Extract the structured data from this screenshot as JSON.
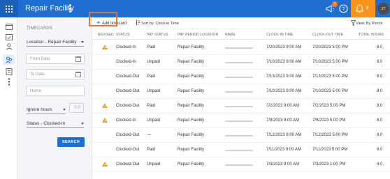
{
  "app": {
    "title": "Repair Facility",
    "notification_badge": "7",
    "alerts_count": "8",
    "user_initials": "JT",
    "accent_color": "#1f6fd1",
    "alert_color": "#f7941d"
  },
  "rail_icons": [
    "calendar-icon",
    "calendar-check-icon",
    "user-icon",
    "users-icon",
    "document-icon",
    "more-icon"
  ],
  "filters": {
    "title": "TIMECARDS",
    "location": "Location - Repair Facility",
    "from_date_placeholder": "From Date",
    "to_date_placeholder": "To Date",
    "name_placeholder": "Name",
    "ignore_hours": "Ignore hours",
    "ignore_value": "0.0",
    "status": "Status - Clocked-In",
    "search_label": "SEARCH"
  },
  "toolbar": {
    "add_label": "Add timecard",
    "sort_label": "Sort by: Clock-in Time",
    "view_label": "View: By Punch"
  },
  "columns": [
    "REVISED",
    "STATUS",
    "PAY STATUS",
    "PAY PERIOD LOCATION",
    "NAME",
    "CLOCK-IN TIME",
    "CLOCK-OUT TIME",
    "TOTAL HOURS"
  ],
  "rows": [
    {
      "revised": true,
      "status": "Clocked-In",
      "pay_status": "Paid",
      "location": "Repair Facility",
      "clock_in": "7/20/2023 9:00 AM",
      "clock_out": "7/20/2023 5:00 PM",
      "hours": "8.0"
    },
    {
      "revised": false,
      "status": "Clocked-In",
      "pay_status": "Unpaid",
      "location": "Repair Facility",
      "clock_in": "7/10/2023 9:00 AM",
      "clock_out": "7/10/2023 5:00 PM",
      "hours": "8.0"
    },
    {
      "revised": false,
      "status": "Clocked-Out",
      "pay_status": "Paid",
      "location": "Repair Facility",
      "clock_in": "7/13/2023 9:00 AM",
      "clock_out": "7/13/2023 5:00 PM",
      "hours": "8.0"
    },
    {
      "revised": false,
      "status": "Clocked-Out",
      "pay_status": "Unpaid",
      "location": "Repair Facility",
      "clock_in": "7/10/2023 9:00 AM",
      "clock_out": "7/10/2023 5:00 PM",
      "hours": "8.0"
    },
    {
      "revised": true,
      "status": "Clocked-Out",
      "pay_status": "Paid",
      "location": "Repair Facility",
      "clock_in": "7/2/2023 9:00 AM",
      "clock_out": "7/2/2023 5:00 PM",
      "hours": "8.0"
    },
    {
      "revised": true,
      "status": "Clocked-In",
      "pay_status": "Unpaid",
      "location": "Repair Facility",
      "clock_in": "7/9/2023 9:00 AM",
      "clock_out": "7/9/2023 5:00 PM",
      "hours": "8.0"
    },
    {
      "revised": false,
      "status": "Clocked-Out",
      "pay_status": "—",
      "location": "Repair Facility",
      "clock_in": "7/12/2023 9:00 AM",
      "clock_out": "7/12/2023 5:00 PM",
      "hours": "8.0"
    },
    {
      "revised": false,
      "status": "Clocked-Out",
      "pay_status": "Paid",
      "location": "Repair Facility",
      "clock_in": "7/11/2023 9:00 AM",
      "clock_out": "7/11/2023 5:00 PM",
      "hours": "8.0"
    },
    {
      "revised": true,
      "status": "Clocked-Out",
      "pay_status": "Unpaid",
      "location": "Repair Facility",
      "clock_in": "7/3/2023 9:00 AM",
      "clock_out": "7/3/2023 1:00 PM",
      "hours": "4.0"
    }
  ]
}
